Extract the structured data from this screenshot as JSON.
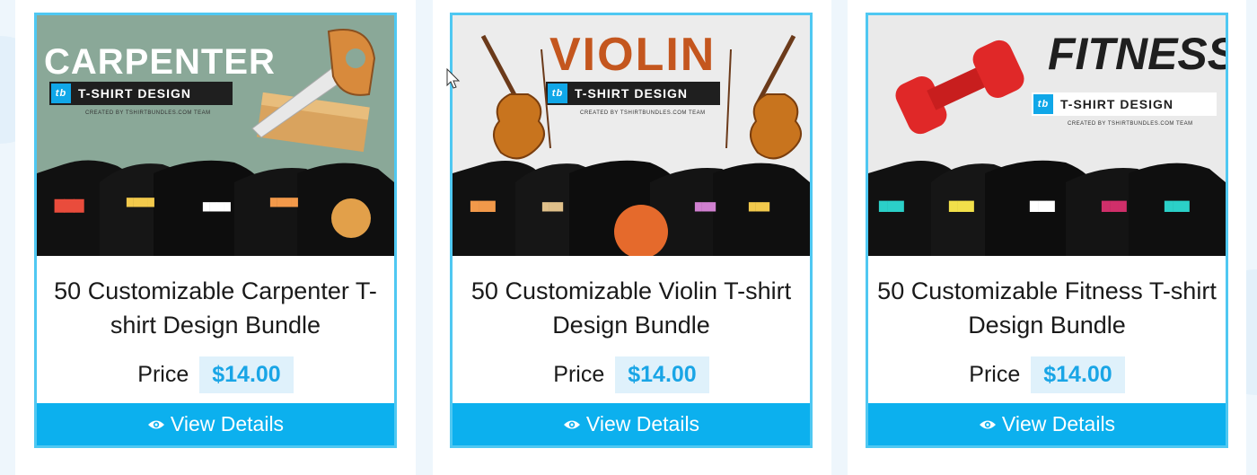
{
  "products": [
    {
      "banner": {
        "heading": "CARPENTER",
        "tagline": "T-SHIRT DESIGN",
        "logo": "tb",
        "credit": "CREATED BY TSHIRTBUNDLES.COM TEAM",
        "bg_color": "#8aa898",
        "heading_color": "#ffffff"
      },
      "title": "50 Customizable Carpenter T-shirt Design Bundle",
      "price_label": "Price",
      "price": "$14.00",
      "button_label": "View Details",
      "button_icon": "eye-icon"
    },
    {
      "banner": {
        "heading": "VIOLIN",
        "tagline": "T-SHIRT DESIGN",
        "logo": "tb",
        "credit": "CREATED BY TSHIRTBUNDLES.COM TEAM",
        "bg_color": "#ececec",
        "heading_color": "#c4561e"
      },
      "title": "50 Customizable Violin T-shirt Design Bundle",
      "price_label": "Price",
      "price": "$14.00",
      "button_label": "View Details",
      "button_icon": "eye-icon"
    },
    {
      "banner": {
        "heading": "FITNESS",
        "tagline": "T-SHIRT DESIGN",
        "logo": "tb",
        "credit": "CREATED BY TSHIRTBUNDLES.COM TEAM",
        "bg_color": "#eaeaea",
        "heading_color": "#1f1f1f"
      },
      "title": "50 Customizable Fitness T-shirt Design Bundle",
      "price_label": "Price",
      "price": "$14.00",
      "button_label": "View Details",
      "button_icon": "eye-icon"
    }
  ],
  "colors": {
    "card_border": "#4fc8f2",
    "button_bg": "#0cb0ee",
    "price_bg": "#dff1fb",
    "price_text": "#19a5e6"
  }
}
